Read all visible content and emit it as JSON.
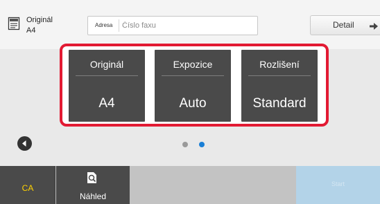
{
  "original_info": {
    "label": "Originál",
    "size": "A4"
  },
  "address": {
    "label": "Adresa",
    "placeholder": "Číslo faxu",
    "value": ""
  },
  "detail": {
    "label": "Detail"
  },
  "settings": [
    {
      "title": "Originál",
      "value": "A4"
    },
    {
      "title": "Expozice",
      "value": "Auto"
    },
    {
      "title": "Rozlišení",
      "value": "Standard"
    }
  ],
  "pagination": {
    "page_count": 2,
    "active_page": 2
  },
  "bottom": {
    "ca_label": "CA",
    "preview_label": "Náhled",
    "start_label": "Start"
  },
  "colors": {
    "highlight_border": "#e21a33",
    "tile_bg": "#4a4a4a",
    "ca_text": "#ffd200",
    "start_bg": "#b3d3e8",
    "active_dot": "#1a7fd6",
    "inactive_dot": "#9a9a9a"
  },
  "icons": {
    "original": "document-icon",
    "detail": "arrow-right-icon",
    "prev": "chevron-left-icon",
    "preview": "preview-magnifier-icon"
  }
}
